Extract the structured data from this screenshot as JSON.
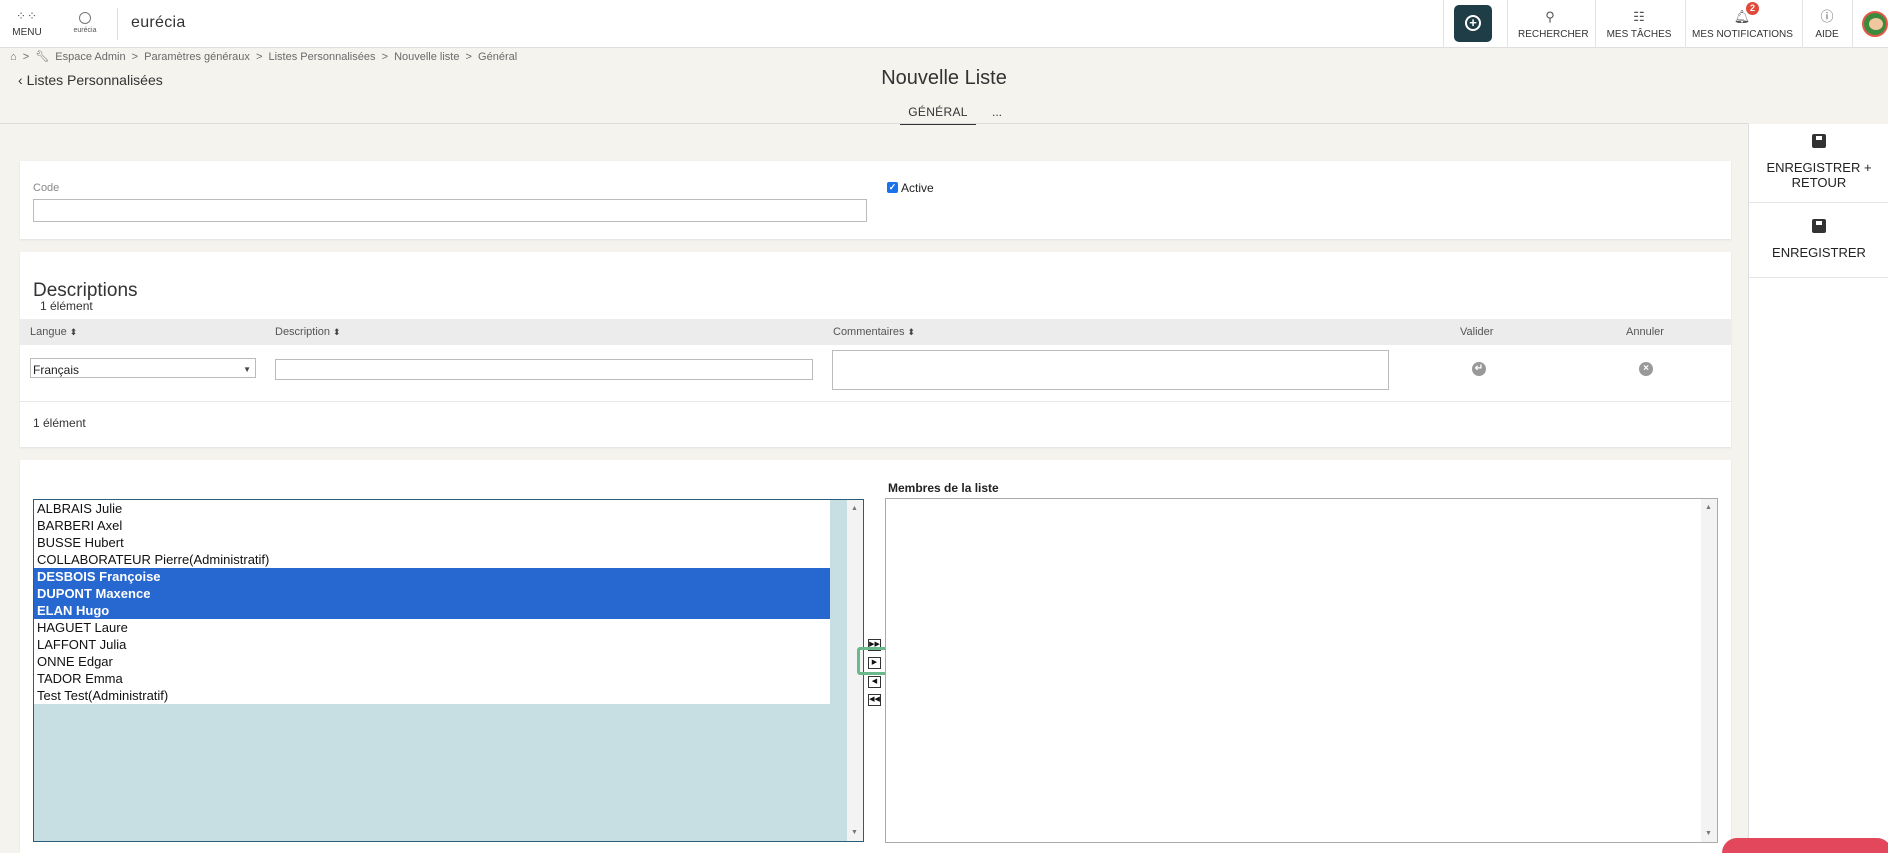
{
  "topbar": {
    "menu_label": "MENU",
    "logo_small_text": "eurécia",
    "brand": "eurécia",
    "search_label": "RECHERCHER",
    "tasks_label": "MES TÂCHES",
    "notifications_label": "MES NOTIFICATIONS",
    "notifications_count": "2",
    "help_label": "AIDE"
  },
  "breadcrumb": {
    "sep": ">",
    "items": [
      "Espace Admin",
      "Paramètres généraux",
      "Listes Personnalisées",
      "Nouvelle liste",
      "Général"
    ]
  },
  "header": {
    "back_label": "Listes Personnalisées",
    "title": "Nouvelle Liste",
    "tabs": [
      "GÉNÉRAL",
      "..."
    ]
  },
  "actions": {
    "save_return_line1": "ENREGISTRER +",
    "save_return_line2": "RETOUR",
    "save": "ENREGISTRER"
  },
  "general_form": {
    "code_label": "Code",
    "code_value": "",
    "active_label": "Active",
    "active_checked": true
  },
  "descriptions": {
    "title": "Descriptions",
    "count_top": "1 élément",
    "count_bottom": "1 élément",
    "columns": [
      "Langue",
      "Description",
      "Commentaires",
      "Valider",
      "Annuler"
    ],
    "row": {
      "language": "Français",
      "description": "",
      "comment": ""
    }
  },
  "members": {
    "available": [
      {
        "name": "ALBRAIS Julie",
        "selected": false
      },
      {
        "name": "BARBERI Axel",
        "selected": false
      },
      {
        "name": "BUSSE Hubert",
        "selected": false
      },
      {
        "name": "COLLABORATEUR Pierre(Administratif)",
        "selected": false
      },
      {
        "name": "DESBOIS Françoise",
        "selected": true
      },
      {
        "name": "DUPONT Maxence",
        "selected": true
      },
      {
        "name": "ELAN Hugo",
        "selected": true
      },
      {
        "name": "HAGUET Laure",
        "selected": false
      },
      {
        "name": "LAFFONT Julia",
        "selected": false
      },
      {
        "name": "ONNE Edgar",
        "selected": false
      },
      {
        "name": "TADOR Emma",
        "selected": false
      },
      {
        "name": "Test Test(Administratif)",
        "selected": false
      }
    ],
    "members_label": "Membres de la liste",
    "members_list": []
  },
  "colors": {
    "accent_dark": "#1f3d47",
    "selection_blue": "#2767d0",
    "focus_green": "#6bb88d",
    "chat_red": "#e2475b"
  }
}
